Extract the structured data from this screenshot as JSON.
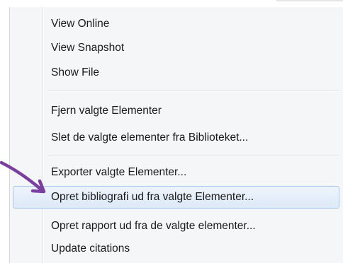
{
  "menu": {
    "items": [
      {
        "label": "View Online"
      },
      {
        "label": "View Snapshot"
      },
      {
        "label": "Show File"
      },
      {
        "label": "Fjern valgte Elementer"
      },
      {
        "label": "Slet de valgte elementer fra Biblioteket..."
      },
      {
        "label": "Exporter valgte Elementer..."
      },
      {
        "label": "Opret bibliografi ud fra valgte Elementer..."
      },
      {
        "label": "Opret rapport ud fra de valgte elementer..."
      },
      {
        "label": "Update citations"
      }
    ],
    "selected_index": 6
  },
  "colors": {
    "arrow": "#7b3fa0",
    "highlight_border": "#a8c8eb",
    "menu_background": "#f5f6f7"
  },
  "icons": {
    "pointer": "arrow-pointer-icon"
  }
}
